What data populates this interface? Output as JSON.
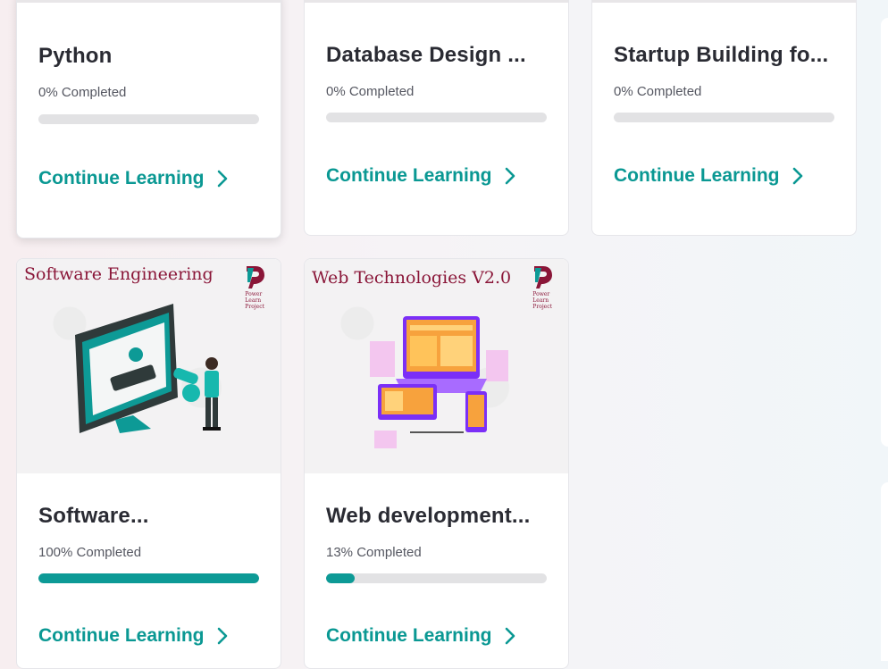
{
  "courses": [
    {
      "title": "Python",
      "progress_text": "0% Completed",
      "progress": 0,
      "cta": "Continue Learning"
    },
    {
      "title": "Database Design ...",
      "progress_text": "0% Completed",
      "progress": 0,
      "cta": "Continue Learning"
    },
    {
      "title": "Startup Building fo...",
      "progress_text": "0% Completed",
      "progress": 0,
      "cta": "Continue Learning"
    },
    {
      "title": "Software...",
      "thumb_title": "Software Engineering",
      "progress_text": "100% Completed",
      "progress": 100,
      "cta": "Continue Learning"
    },
    {
      "title": "Web development...",
      "thumb_title": "Web Technologies V2.0",
      "progress_text": "13% Completed",
      "progress": 13,
      "cta": "Continue Learning"
    }
  ],
  "logo_text": [
    "Power",
    "Learn",
    "Project"
  ],
  "colors": {
    "accent": "#0a9893",
    "progress_fill": "#0d9a96",
    "brand_maroon": "#8a1638"
  }
}
